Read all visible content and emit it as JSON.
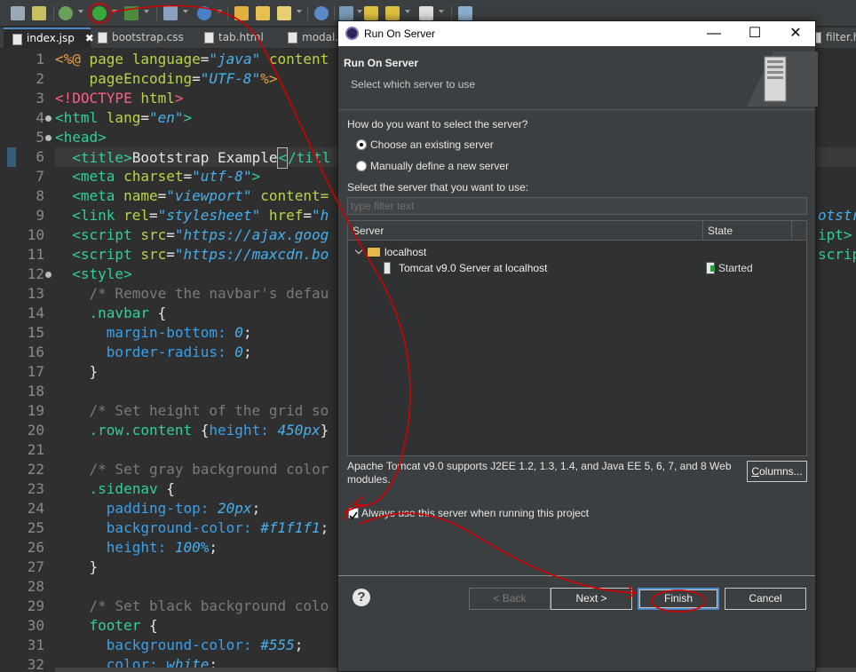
{
  "colors": {
    "editor_bg": "#2f2f2f",
    "dialog_bg": "#3c3f41",
    "annotation_red": "#d40000",
    "focus_blue": "#4a88c7"
  },
  "toolbar": {
    "icons": [
      "save-all-icon",
      "toggle-comment-icon",
      "debug-icon",
      "run-icon",
      "run-on-server-icon",
      "new-server-icon",
      "globe-icon",
      "open-folder-icon",
      "open-file-icon",
      "pen-icon",
      "web-browser-icon",
      "search-icon",
      "back-icon",
      "forward-icon",
      "new-window-icon"
    ]
  },
  "tabs": [
    {
      "label": "index.jsp",
      "active": true,
      "close": "✖"
    },
    {
      "label": "bootstrap.css"
    },
    {
      "label": "tab.html"
    },
    {
      "label": "modal.h"
    },
    {
      "label": "filter.h"
    }
  ],
  "editor": {
    "line_numbers": [
      "1",
      "2",
      "3",
      "4",
      "5",
      "6",
      "7",
      "8",
      "9",
      "10",
      "11",
      "12",
      "13",
      "14",
      "15",
      "16",
      "17",
      "18",
      "19",
      "20",
      "21",
      "22",
      "23",
      "24",
      "25",
      "26",
      "27",
      "28",
      "29",
      "30",
      "31",
      "32"
    ],
    "right_fragments": [
      "otstr",
      "ipt>",
      "scrip"
    ]
  },
  "dialog": {
    "title": "Run On Server",
    "win_controls": {
      "minimize": "—",
      "maximize": "☐",
      "close": "✕"
    },
    "banner": {
      "title": "Run On Server",
      "subtitle": "Select which server to use"
    },
    "question": "How do you want to select the server?",
    "options": [
      {
        "label": "Choose an existing server",
        "checked": true
      },
      {
        "label": "Manually define a new server",
        "checked": false
      }
    ],
    "select_label": "Select the server that you want to use:",
    "filter_placeholder": "type filter text",
    "table": {
      "columns": [
        "Server",
        "State"
      ],
      "rows": [
        {
          "name": "localhost",
          "state": ""
        },
        {
          "name": "Tomcat v9.0 Server at localhost",
          "state": "Started"
        }
      ]
    },
    "description": "Apache Tomcat v9.0 supports J2EE 1.2, 1.3, 1.4, and Java EE 5, 6, 7, and 8 Web modules.",
    "columns_button": "Columns...",
    "always_use_label": "Always use this server when running this project",
    "always_use_checked": true,
    "help_icon": "?",
    "buttons": {
      "back": "< Back",
      "next": "Next >",
      "finish": "Finish",
      "cancel": "Cancel"
    }
  }
}
